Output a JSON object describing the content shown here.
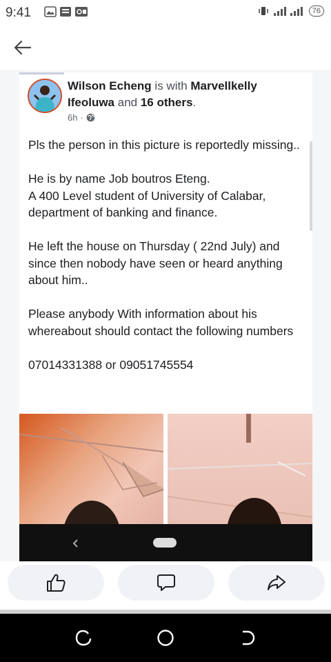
{
  "status_bar": {
    "time": "9:41",
    "battery": "76"
  },
  "post": {
    "author": "Wilson Echeng",
    "with_text": " is with ",
    "tagged": "Marvellkelly Ifeoluwa",
    "and_text": " and ",
    "others": "16 others",
    "period": ".",
    "time": "6h",
    "dot": "·",
    "paragraphs": [
      "Pls the person in this picture is reportedly missing..",
      "He is by name Job boutros Eteng.",
      "A 400 Level student of University of Calabar, department of banking and finance.",
      "He left the house on Thursday ( 22nd July) and since then nobody have seen or heard anything about him..",
      "Please anybody With information about his whereabout should contact the following numbers",
      "07014331388 or 09051745554"
    ]
  },
  "icons": {
    "back": "back-arrow-icon",
    "like": "like-icon",
    "comment": "comment-icon",
    "share": "share-icon"
  }
}
